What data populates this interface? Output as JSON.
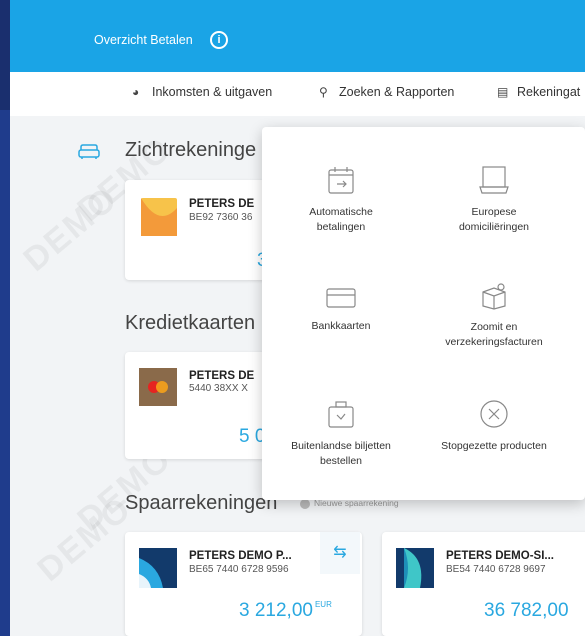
{
  "header": {
    "title": "Overzicht Betalen",
    "info_icon": "i"
  },
  "nav": [
    {
      "icon": "pie-icon",
      "glyph": "◕",
      "label": "Inkomsten & uitgaven"
    },
    {
      "icon": "search-icon",
      "glyph": "⚲",
      "label": "Zoeken & Rapporten"
    },
    {
      "icon": "report-icon",
      "glyph": "▤",
      "label": "Rekeningat"
    }
  ],
  "sections": {
    "current": {
      "title": "Zichtrekeninge"
    },
    "credit": {
      "title": "Kredietkaarten"
    },
    "savings": {
      "title": "Spaarrekeningen",
      "new_link": "Nieuwe spaarrekening"
    }
  },
  "accounts": {
    "current": {
      "name": "PETERS DE",
      "iban": "BE92 7360 36",
      "amount": "3"
    },
    "credit": {
      "name": "PETERS DE",
      "iban": "5440 38XX X",
      "amount": "5 0"
    },
    "savings1": {
      "name": "PETERS DEMO P...",
      "iban": "BE65 7440 6728 9596",
      "amount": "3 212,00",
      "currency": "EUR"
    },
    "savings2": {
      "name": "PETERS DEMO-SI...",
      "iban": "BE54 7440 6728 9697",
      "amount": "36 782,00",
      "currency": ""
    }
  },
  "menu": {
    "items": [
      {
        "icon": "calendar-icon",
        "label_line1": "Automatische",
        "label_line2": "betalingen"
      },
      {
        "icon": "document-stack-icon",
        "label_line1": "Europese",
        "label_line2": "domiciliëringen"
      },
      {
        "icon": "credit-card-icon",
        "label_line1": "Bankkaarten",
        "label_line2": ""
      },
      {
        "icon": "gift-box-icon",
        "label_line1": "Zoomit en",
        "label_line2": "verzekeringsfacturen"
      },
      {
        "icon": "wallet-icon",
        "label_line1": "Buitenlandse biljetten",
        "label_line2": "bestellen"
      },
      {
        "icon": "close-circle-icon",
        "label_line1": "Stopgezette producten",
        "label_line2": ""
      }
    ]
  },
  "watermark": "DEMO",
  "colors": {
    "accent": "#1aa4e6",
    "amount": "#2aa8e0",
    "background": "#f2f4f6"
  }
}
